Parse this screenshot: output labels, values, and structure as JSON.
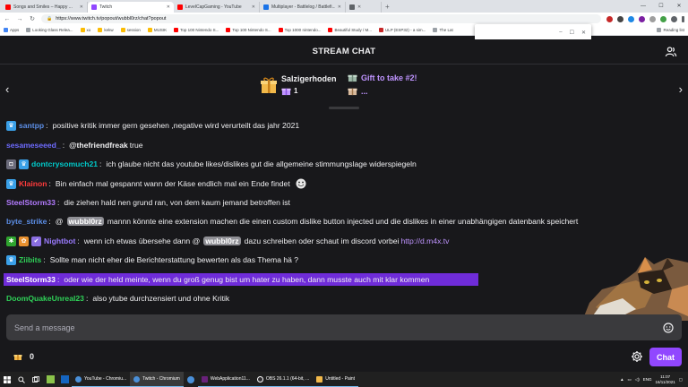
{
  "browser": {
    "tabs": [
      {
        "label": "Songs and Smiles – Happy ...",
        "color": "#ff0000"
      },
      {
        "label": "Twitch",
        "color": "#9147ff",
        "active": true
      },
      {
        "label": "LevelCapGaming - YouTube",
        "color": "#ff0000"
      },
      {
        "label": "Multiplayer - Battlelog / Battlefi...",
        "color": "#1a73e8"
      },
      {
        "label": "",
        "color": "#5f6368"
      }
    ],
    "url": "https://www.twitch.tv/popout/wubbl0rz/chat?popout",
    "bookmarks": [
      "Apps",
      "Looking Glass Relea...",
      "xo",
      "kekw",
      "session",
      "MUSIK",
      "Top 100 Nintendo S...",
      "Top 100 Nintendo S...",
      "Top 1000 nintendo...",
      "Beautiful Study / M...",
      "ULP (ESP32) - a sim...",
      "The Lat"
    ],
    "reading_list": "Reading list",
    "popup": {
      "minimize": "–",
      "maximize": "☐",
      "close": "✕"
    }
  },
  "chat": {
    "title": "STREAM CHAT",
    "gift": {
      "main_name": "Salzigerhoden",
      "main_count": "1",
      "second_label": "Gift to take #2!",
      "second_dots": "..."
    },
    "messages": [
      {
        "user": "santpp",
        "color": "#5c8ee6",
        "badges": [
          "sub"
        ],
        "text": "positive kritik immer gern gesehen ,negative wird verurteilt das jahr 2021"
      },
      {
        "user": "sesameseeed_",
        "color": "#6e6bff",
        "badges": [],
        "mention": "@thefriendfreak",
        "text": " true"
      },
      {
        "user": "dontcrysomuch21",
        "color": "#00c9c9",
        "badges": [
          "robot",
          "sub"
        ],
        "text": "ich glaube nicht das youtube likes/dislikes gut die allgemeine stimmungslage widerspiegeln"
      },
      {
        "user": "Klainon",
        "color": "#ff3b3b",
        "badges": [
          "sub"
        ],
        "text": "Bin einfach mal gespannt wann der Käse endlich mal ein Ende findet"
      },
      {
        "user": "SteelStorm33",
        "color": "#b37bff",
        "badges": [],
        "text": "die ziehen hald nen grund ran, von dem kaum jemand betroffen ist"
      },
      {
        "user": "byte_strike",
        "color": "#5c8ee6",
        "badges": [],
        "text_pre": "@",
        "mention": "wubbl0rz",
        "text": " mannn könnte eine extension machen die einen custom dislike button injected und die dislikes in einer unabhängigen datenbank speichert"
      },
      {
        "user": "Nightbot",
        "color": "#9b7bff",
        "badges": [
          "green",
          "orange",
          "check"
        ],
        "text": "wenn ich etwas übersehe dann @",
        "mention": "wubbl0rz",
        "text2": " dazu schreiben oder schaut im discord vorbei ",
        "link": "http://d.m4x.tv"
      },
      {
        "user": "Ziibits",
        "color": "#2fd158",
        "badges": [
          "sub"
        ],
        "text": "Sollte man nicht eher die Berichterstattung bewerten als das Thema hä ?"
      },
      {
        "user": "SteelStorm33",
        "color": "#ffffff",
        "badges": [],
        "text": "oder wie der held meinte, wenn du groß genug bist um hater zu haben, dann musste auch mit klar kommen",
        "highlight": true
      },
      {
        "user": "DoomQuakeUnreal23",
        "color": "#2fd158",
        "badges": [],
        "text": "also ytube durchzensiert und ohne Kritik"
      }
    ],
    "input_placeholder": "Send a message",
    "points": "0",
    "chat_button": "Chat"
  },
  "taskbar": {
    "apps": [
      "YouTube - Chromiu...",
      "Twitch - Chromium",
      "WebApplication11...",
      "OBS 26.1.1 (64-bit, ...",
      "Untitled - Paint"
    ],
    "lang": "ENG",
    "time": "11:07",
    "date": "16/11/2021"
  }
}
